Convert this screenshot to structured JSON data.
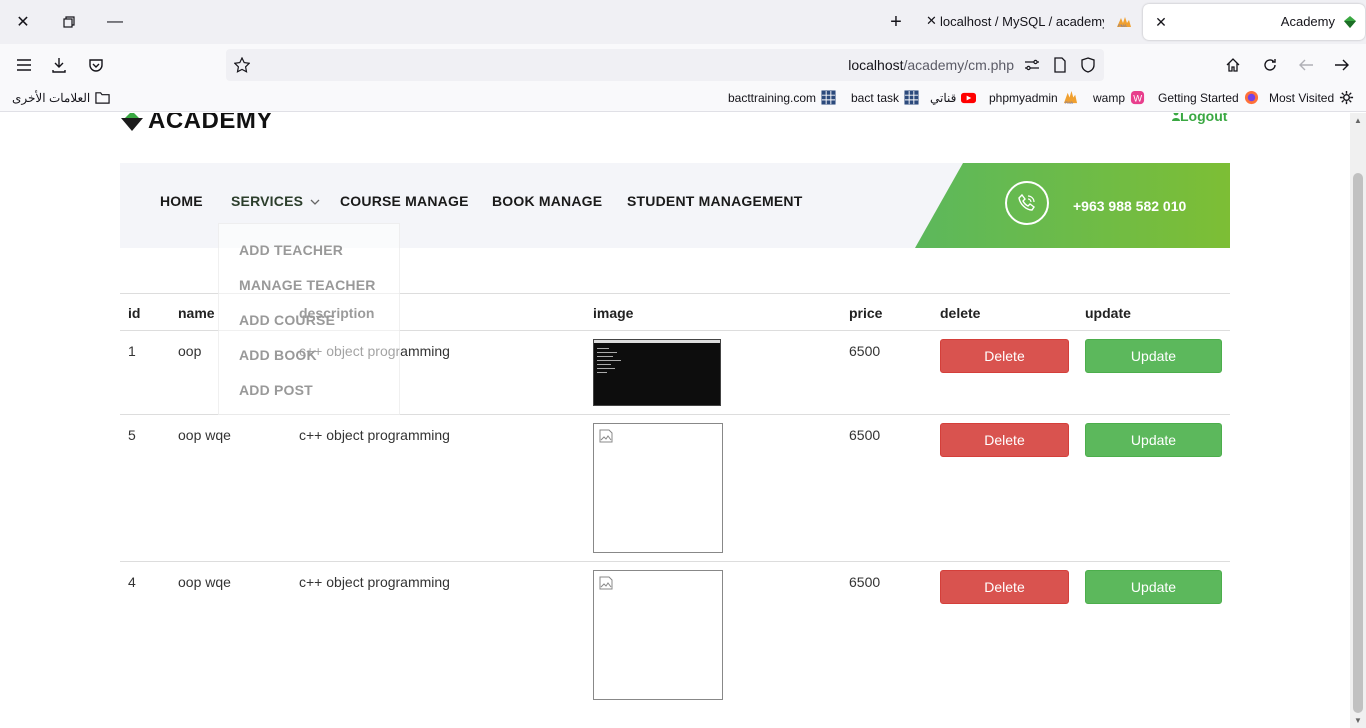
{
  "browser": {
    "tabs": [
      {
        "title": "Academy",
        "active": true
      },
      {
        "title": "localhost / MySQL / academy / ",
        "active": false
      }
    ],
    "url": {
      "host": "localhost",
      "path": "/academy/cm.php"
    },
    "bookmarks": [
      {
        "label": "Most Visited",
        "icon": "gear-icon"
      },
      {
        "label": "Getting Started",
        "icon": "firefox-icon"
      },
      {
        "label": "wamp",
        "icon": "wamp-icon"
      },
      {
        "label": "phpmyadmin",
        "icon": "pma-icon"
      },
      {
        "label": "قناتي",
        "icon": "youtube-icon"
      },
      {
        "label": "bact task",
        "icon": "grid-icon"
      },
      {
        "label": "bacttraining.com",
        "icon": "grid-icon"
      },
      {
        "label": "العلامات الأخرى",
        "icon": "folder-icon"
      }
    ]
  },
  "site": {
    "logo": "ACADEMY",
    "logout": "Logout",
    "menu": [
      "HOME",
      "SERVICES",
      "COURSE MANAGE",
      "BOOK MANAGE",
      "STUDENT MANAGEMENT"
    ],
    "phone": "+963 988 582 010",
    "dropdown": [
      "ADD TEACHER",
      "MANAGE TEACHER",
      "ADD COURSE",
      "ADD BOOK",
      "ADD POST"
    ],
    "colors": {
      "accent": "#5cb85c",
      "danger": "#d9534f",
      "brand": "#3aa842"
    }
  },
  "table": {
    "headers": [
      "id",
      "name",
      "description",
      "image",
      "price",
      "delete",
      "update"
    ],
    "rows": [
      {
        "id": "1",
        "name": "oop",
        "description": "c++ object programming",
        "image": "screenshot",
        "price": "6500",
        "delete": "Delete",
        "update": "Update"
      },
      {
        "id": "5",
        "name": "oop wqe",
        "description": "c++ object programming",
        "image": "broken",
        "price": "6500",
        "delete": "Delete",
        "update": "Update"
      },
      {
        "id": "4",
        "name": "oop wqe",
        "description": "c++ object programming",
        "image": "broken",
        "price": "6500",
        "delete": "Delete",
        "update": "Update"
      }
    ]
  }
}
